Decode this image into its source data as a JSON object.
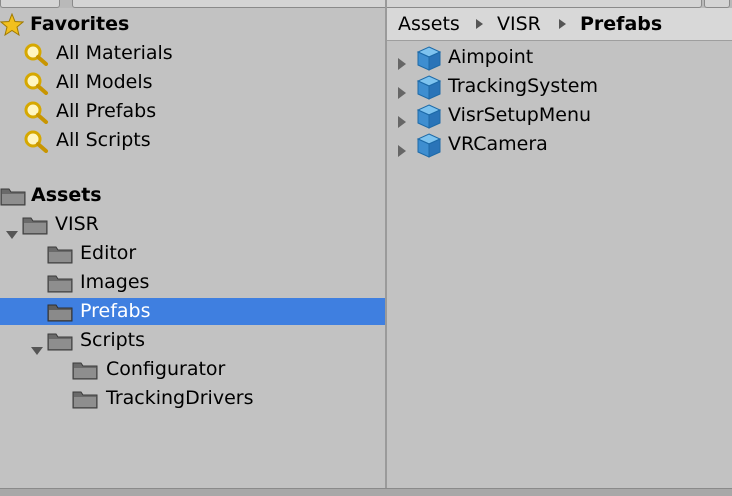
{
  "favorites": {
    "title": "Favorites",
    "items": [
      {
        "label": "All Materials"
      },
      {
        "label": "All Models"
      },
      {
        "label": "All Prefabs"
      },
      {
        "label": "All Scripts"
      }
    ]
  },
  "assets": {
    "root": "Assets",
    "tree": [
      {
        "label": "VISR"
      },
      {
        "label": "Editor"
      },
      {
        "label": "Images"
      },
      {
        "label": "Prefabs",
        "selected": true
      },
      {
        "label": "Scripts"
      },
      {
        "label": "Configurator"
      },
      {
        "label": "TrackingDrivers"
      }
    ]
  },
  "breadcrumb": [
    "Assets",
    "VISR",
    "Prefabs"
  ],
  "contents": [
    {
      "label": "Aimpoint"
    },
    {
      "label": "TrackingSystem"
    },
    {
      "label": "VisrSetupMenu"
    },
    {
      "label": "VRCamera"
    }
  ],
  "colors": {
    "panel": "#c2c2c2",
    "selection": "#3f7fe0",
    "breadcrumb_bg": "#d8d8d8"
  },
  "icons": {
    "favorites": "star-icon",
    "search": "magnifier-icon",
    "folder": "folder-icon",
    "prefab": "prefab-cube-icon"
  }
}
